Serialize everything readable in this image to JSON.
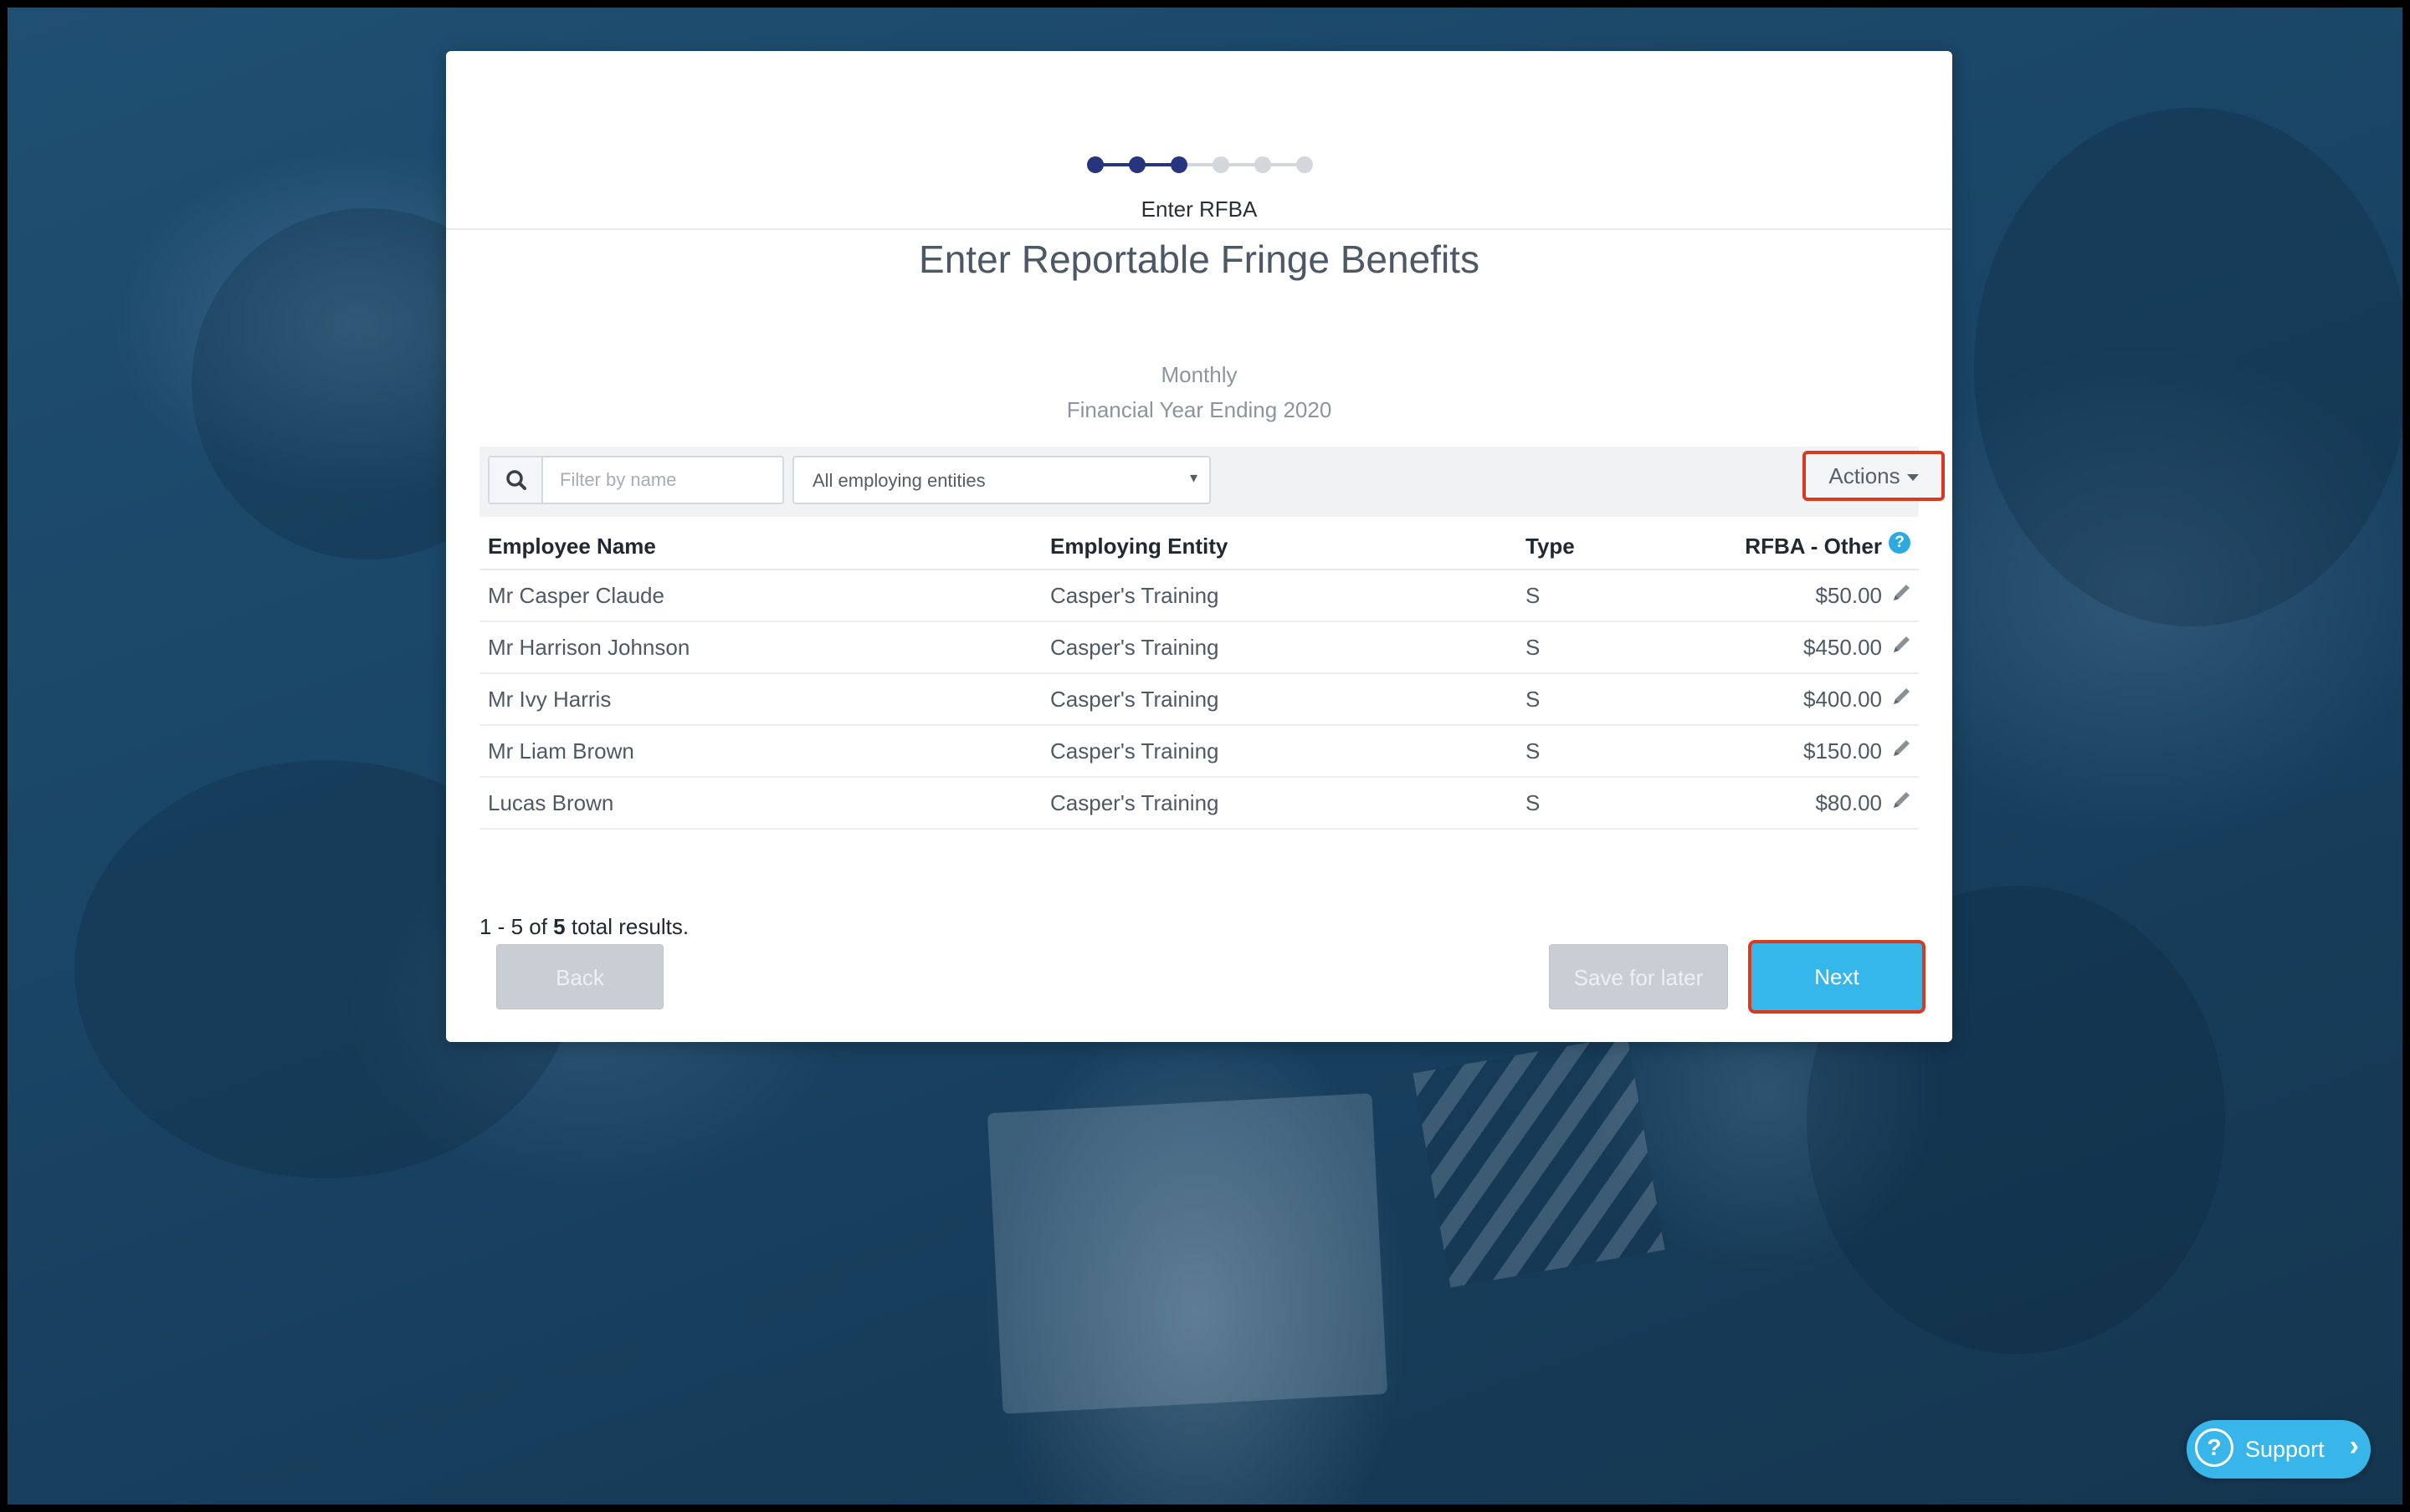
{
  "stepper": {
    "current_step_label": "Enter RFBA",
    "steps": [
      {
        "state": "complete"
      },
      {
        "state": "complete"
      },
      {
        "state": "current"
      },
      {
        "state": "pending"
      },
      {
        "state": "pending"
      },
      {
        "state": "pending"
      }
    ]
  },
  "header": {
    "title": "Enter Reportable Fringe Benefits",
    "frequency": "Monthly",
    "financial_year": "Financial Year Ending 2020"
  },
  "toolbar": {
    "search_icon": "search-icon",
    "filter_placeholder": "Filter by name",
    "entity_select_value": "All employing entities",
    "actions_label": "Actions"
  },
  "table": {
    "columns": {
      "name": "Employee Name",
      "entity": "Employing Entity",
      "type": "Type",
      "amount": "RFBA - Other"
    },
    "rows": [
      {
        "name": "Mr Casper Claude",
        "entity": "Casper's Training",
        "type": "S",
        "amount": "$50.00"
      },
      {
        "name": "Mr Harrison Johnson",
        "entity": "Casper's Training",
        "type": "S",
        "amount": "$450.00"
      },
      {
        "name": "Mr Ivy Harris",
        "entity": "Casper's Training",
        "type": "S",
        "amount": "$400.00"
      },
      {
        "name": "Mr Liam Brown",
        "entity": "Casper's Training",
        "type": "S",
        "amount": "$150.00"
      },
      {
        "name": "Lucas Brown",
        "entity": "Casper's Training",
        "type": "S",
        "amount": "$80.00"
      }
    ]
  },
  "results": {
    "range": "1 - 5 of",
    "total": "5",
    "suffix": "total results."
  },
  "buttons": {
    "back": "Back",
    "save_for_later": "Save for later",
    "next": "Next"
  },
  "support": {
    "label": "Support"
  },
  "colors": {
    "step_complete": "#27357e",
    "step_pending": "#d3d6da",
    "accent": "#35b7ec",
    "highlight": "#d93a1e",
    "disabled_button": "#c9ced4"
  }
}
